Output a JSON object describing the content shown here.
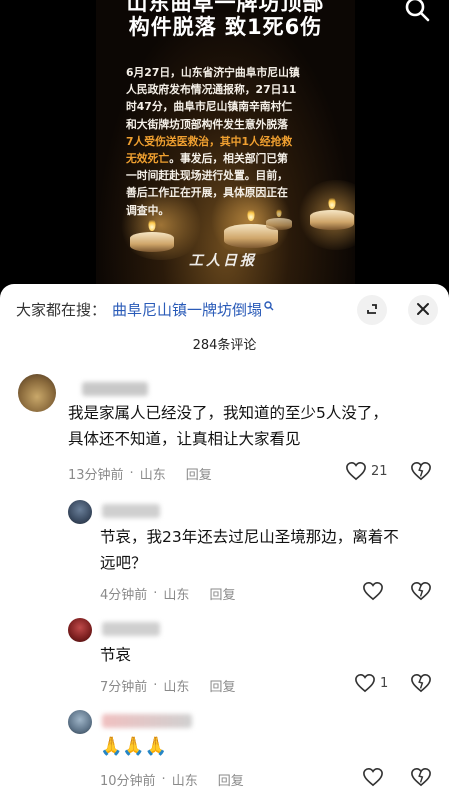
{
  "video": {
    "headline_line1": "山东曲阜一牌坊顶部",
    "headline_line2": "构件脱落 致1死6伤",
    "bulletin": [
      {
        "text": "6月27日，山东省济宁曲阜市尼山镇",
        "hl": ""
      },
      {
        "text": "人民政府发布情况通报称，27日11",
        "hl": ""
      },
      {
        "text": "时47分，曲阜市尼山镇南辛南村仁",
        "hl": ""
      },
      {
        "text": "和大街牌坊顶部构件发生意外脱落",
        "hl": ""
      },
      {
        "text": "",
        "hl": "7人受伤送医救治，其中1人经抢救"
      },
      {
        "text": "。事发后，相关部门已第",
        "hl": "无效死亡"
      },
      {
        "text": "一时间赶赴现场进行处置。目前，",
        "hl": ""
      },
      {
        "text": "善后工作正在开展，具体原因正在",
        "hl": ""
      },
      {
        "text": "调查中。",
        "hl": ""
      }
    ],
    "logo": "工人日报"
  },
  "sheet": {
    "search_prefix": "大家都在搜：",
    "search_term": "曲阜尼山镇一牌坊倒塌",
    "comment_count": "284条评论"
  },
  "comments": [
    {
      "text_lines": [
        "我是家属人已经没了，我知道的至少5人没了，",
        "具体还不知道，让真相让大家看见"
      ],
      "time": "13分钟前",
      "location": "山东",
      "reply": "回复",
      "likes": "21"
    },
    {
      "text_lines": [
        "节哀，我23年还去过尼山圣境那边，离着不",
        "远吧？"
      ],
      "time": "4分钟前",
      "location": "山东",
      "reply": "回复",
      "likes": ""
    },
    {
      "text_lines": [
        "节哀"
      ],
      "time": "7分钟前",
      "location": "山东",
      "reply": "回复",
      "likes": "1"
    },
    {
      "text_lines": [
        "🙏🙏🙏"
      ],
      "time": "10分钟前",
      "location": "山东",
      "reply": "回复",
      "likes": ""
    }
  ],
  "colors": {
    "link": "#2a5bb8",
    "highlight": "#f0a030",
    "meta_gray": "#8a8a8a"
  },
  "icons": [
    "search-icon",
    "collapse-icon",
    "close-icon",
    "heart-icon",
    "dislike-icon"
  ]
}
